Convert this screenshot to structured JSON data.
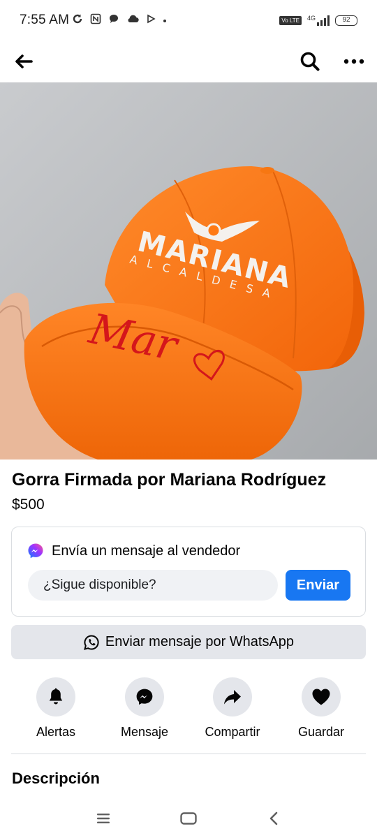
{
  "status_bar": {
    "time": "7:55 AM",
    "battery": "92",
    "network": "4G",
    "volte": "Vo LTE"
  },
  "nav": {
    "back_icon": "arrow-left-icon",
    "search_icon": "search-icon",
    "more_icon": "more-horizontal-icon"
  },
  "listing": {
    "title": "Gorra Firmada por Mariana Rodríguez",
    "price": "$500",
    "photo": {
      "cap_brand": "MARIANA",
      "cap_subtitle": "ALCALDESA",
      "signature": "Mar"
    }
  },
  "message_card": {
    "header": "Envía un mensaje al vendedor",
    "input_value": "¿Sigue disponible?",
    "send_label": "Enviar"
  },
  "whatsapp_button": {
    "label": "Enviar mensaje por WhatsApp"
  },
  "actions": [
    {
      "label": "Alertas",
      "icon": "bell-icon"
    },
    {
      "label": "Mensaje",
      "icon": "messenger-icon"
    },
    {
      "label": "Compartir",
      "icon": "share-icon"
    },
    {
      "label": "Guardar",
      "icon": "heart-icon"
    }
  ],
  "description": {
    "title": "Descripción"
  },
  "colors": {
    "accent": "#1877f2",
    "button_gray": "#e4e6eb",
    "input_gray": "#f0f2f5",
    "cap_orange": "#ff7a14"
  }
}
